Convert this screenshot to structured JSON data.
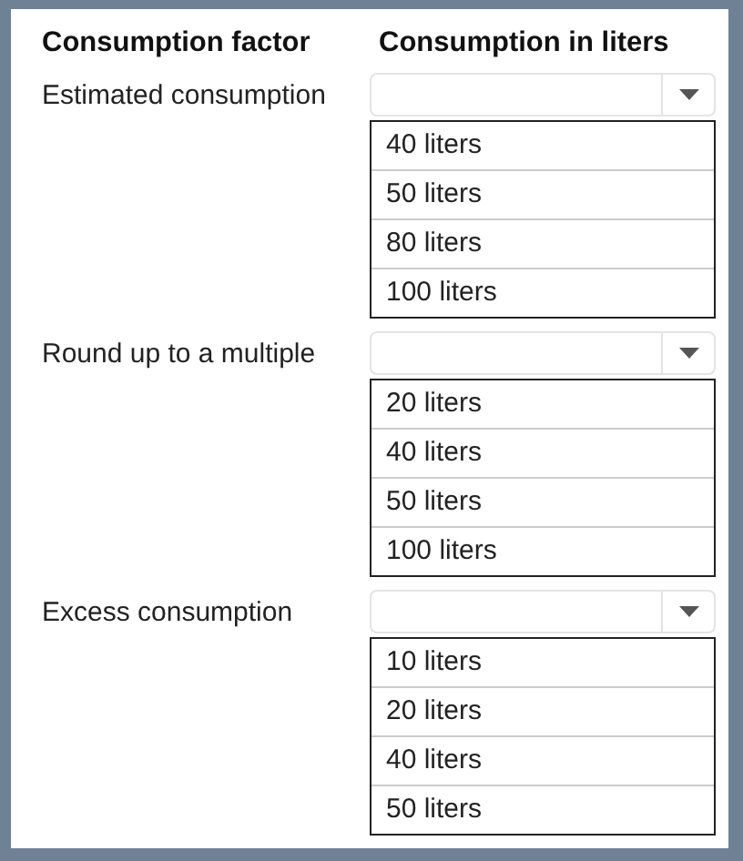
{
  "columns": [
    "Consumption factor",
    "Consumption in liters"
  ],
  "rows": [
    {
      "label": "Estimated consumption",
      "options": [
        "40 liters",
        "50 liters",
        "80 liters",
        "100 liters"
      ]
    },
    {
      "label": "Round up to a multiple",
      "options": [
        "20 liters",
        "40 liters",
        "50 liters",
        "100 liters"
      ]
    },
    {
      "label": "Excess consumption",
      "options": [
        "10 liters",
        "20 liters",
        "40 liters",
        "50 liters"
      ]
    }
  ]
}
